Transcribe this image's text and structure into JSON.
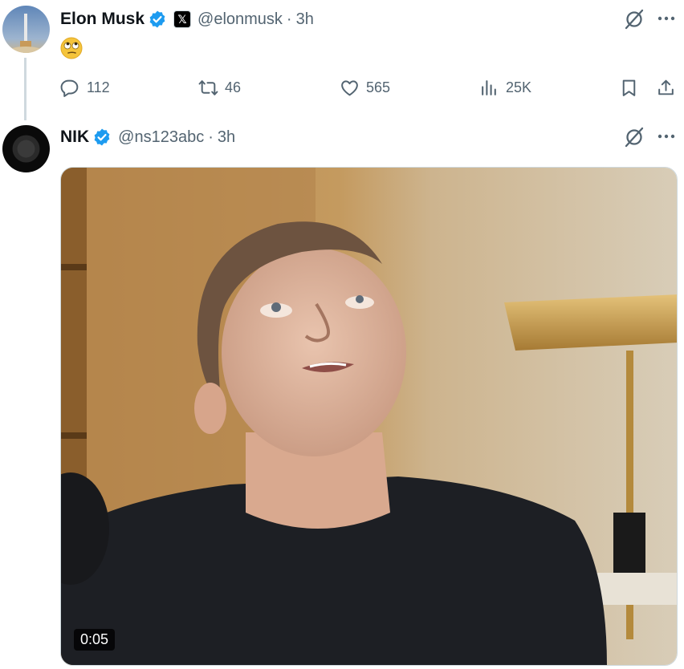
{
  "tweet1": {
    "name": "Elon Musk",
    "handle": "@elonmusk",
    "separator": "·",
    "time": "3h",
    "badge_glyph": "𝕏",
    "content_emoji": "face-with-rolling-eyes",
    "actions": {
      "replies": "112",
      "reposts": "46",
      "likes": "565",
      "views": "25K"
    }
  },
  "tweet2": {
    "name": "NIK",
    "handle": "@ns123abc",
    "separator": "·",
    "time": "3h",
    "video": {
      "duration": "0:05"
    }
  },
  "colors": {
    "verified": "#1d9bf0",
    "muted_text": "#536471",
    "primary_text": "#0f1419",
    "thread_line": "#cfd9de"
  },
  "icons": [
    "grok-icon",
    "more-icon",
    "reply-icon",
    "repost-icon",
    "like-icon",
    "views-icon",
    "bookmark-icon",
    "share-icon",
    "verified-icon"
  ]
}
